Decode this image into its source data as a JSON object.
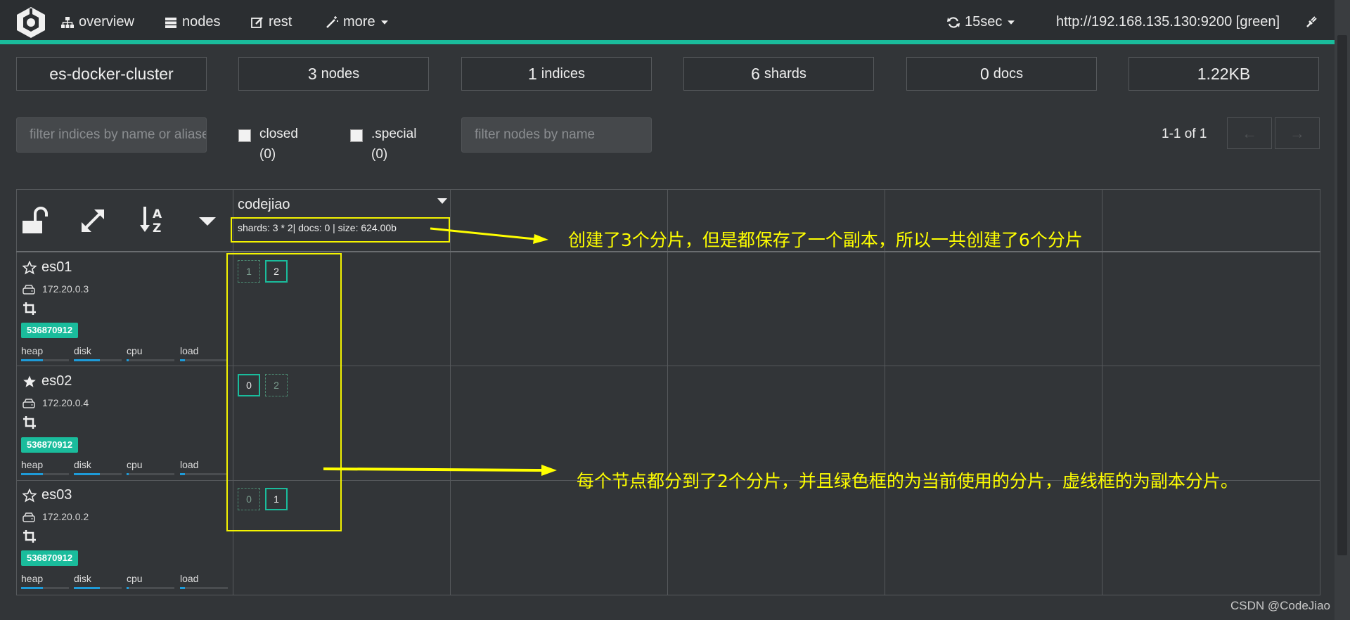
{
  "nav": {
    "overview": "overview",
    "nodes": "nodes",
    "rest": "rest",
    "more": "more",
    "refresh": "15sec",
    "host": "http://192.168.135.130:9200 [green]"
  },
  "stats": {
    "cluster": "es-docker-cluster",
    "nodes_count": "3",
    "nodes_unit": "nodes",
    "indices_count": "1",
    "indices_unit": "indices",
    "shards_count": "6",
    "shards_unit": "shards",
    "docs_count": "0",
    "docs_unit": "docs",
    "size": "1.22KB"
  },
  "filters": {
    "indices_placeholder": "filter indices by name or aliases",
    "closed_label": "closed",
    "closed_count": "(0)",
    "special_label": ".special",
    "special_count": "(0)",
    "nodes_placeholder": "filter nodes by name",
    "pager": "1-1 of 1",
    "prev": "←",
    "next": "→"
  },
  "index": {
    "name": "codejiao",
    "info": "shards: 3 * 2| docs: 0 | size: 624.00b"
  },
  "nodes": [
    {
      "name": "es01",
      "ip": "172.20.0.3",
      "badge": "536870912",
      "master": false,
      "shards": [
        {
          "n": "1",
          "primary": false
        },
        {
          "n": "2",
          "primary": true
        }
      ]
    },
    {
      "name": "es02",
      "ip": "172.20.0.4",
      "badge": "536870912",
      "master": true,
      "shards": [
        {
          "n": "0",
          "primary": true
        },
        {
          "n": "2",
          "primary": false
        }
      ]
    },
    {
      "name": "es03",
      "ip": "172.20.0.2",
      "badge": "536870912",
      "master": false,
      "shards": [
        {
          "n": "0",
          "primary": false
        },
        {
          "n": "1",
          "primary": true
        }
      ]
    }
  ],
  "metrics": {
    "heap": "heap",
    "disk": "disk",
    "cpu": "cpu",
    "load": "load",
    "levels": {
      "heap": 0.45,
      "disk": 0.55,
      "cpu": 0.05,
      "load": 0.1
    }
  },
  "annotations": {
    "top": "创建了3个分片，但是都保存了一个副本，所以一共创建了6个分片",
    "bottom": "每个节点都分到了2个分片，并且绿色框的为当前使用的分片，虚线框的为副本分片。"
  },
  "watermark": "CSDN @CodeJiao",
  "colors": {
    "accent": "#1abc9c",
    "annotation": "#ffff00",
    "background": "#323538"
  }
}
